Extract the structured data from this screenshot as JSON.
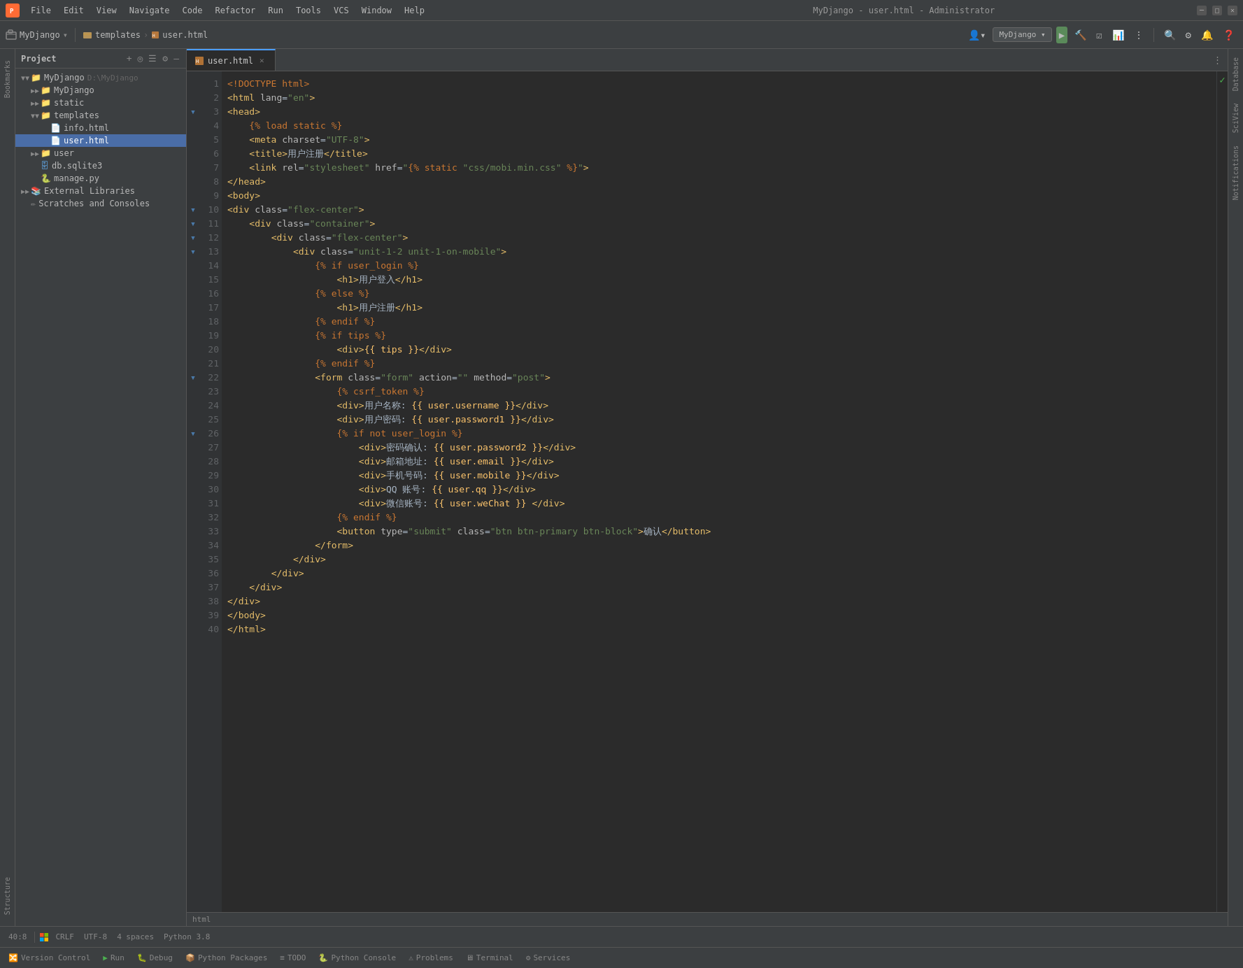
{
  "app": {
    "icon": "🔥",
    "title_bar": {
      "window_title": "MyDjango - user.html - Administrator",
      "menus": [
        "File",
        "Edit",
        "View",
        "Navigate",
        "Code",
        "Refactor",
        "Run",
        "Tools",
        "VCS",
        "Window",
        "Help"
      ],
      "min_btn": "─",
      "max_btn": "□",
      "close_btn": "✕"
    }
  },
  "toolbar": {
    "project_label": "MyDjango",
    "breadcrumb": [
      "templates",
      "user.html"
    ],
    "profile_btn": "👤",
    "project_selector": "MyDjango ▾",
    "run_btn": "▶",
    "more_btn": "⋮"
  },
  "sidebar": {
    "header": "Project",
    "tree": [
      {
        "id": "mydjango-root",
        "label": "MyDjango",
        "path": "D:\\MyDjango",
        "type": "folder",
        "level": 0,
        "open": true
      },
      {
        "id": "mydjango-inner",
        "label": "MyDjango",
        "type": "folder",
        "level": 1,
        "open": false
      },
      {
        "id": "static",
        "label": "static",
        "type": "folder",
        "level": 1,
        "open": false
      },
      {
        "id": "templates",
        "label": "templates",
        "type": "folder",
        "level": 1,
        "open": true
      },
      {
        "id": "info-html",
        "label": "info.html",
        "type": "html",
        "level": 2
      },
      {
        "id": "user-html",
        "label": "user.html",
        "type": "html",
        "level": 2,
        "selected": true
      },
      {
        "id": "user",
        "label": "user",
        "type": "folder",
        "level": 1,
        "open": false
      },
      {
        "id": "db-sqlite",
        "label": "db.sqlite3",
        "type": "db",
        "level": 1
      },
      {
        "id": "manage-py",
        "label": "manage.py",
        "type": "py",
        "level": 1
      },
      {
        "id": "ext-libs",
        "label": "External Libraries",
        "type": "folder",
        "level": 0,
        "open": false
      },
      {
        "id": "scratches",
        "label": "Scratches and Consoles",
        "type": "special",
        "level": 0
      }
    ]
  },
  "editor": {
    "tab_label": "user.html",
    "language": "html",
    "lines": [
      {
        "num": 1,
        "code": "<!DOCTYPE html>",
        "type": "doctype"
      },
      {
        "num": 2,
        "code": "<html lang=\"en\">",
        "type": "html"
      },
      {
        "num": 3,
        "code": "<head>",
        "type": "html"
      },
      {
        "num": 4,
        "code": "    {% load static %}",
        "type": "template"
      },
      {
        "num": 5,
        "code": "    <meta charset=\"UTF-8\">",
        "type": "html"
      },
      {
        "num": 6,
        "code": "    <title>用户注册</title>",
        "type": "html"
      },
      {
        "num": 7,
        "code": "    <link rel=\"stylesheet\" href=\"{% static 'css/mobi.min.css' %}\">",
        "type": "mixed"
      },
      {
        "num": 8,
        "code": "</head>",
        "type": "html"
      },
      {
        "num": 9,
        "code": "<body>",
        "type": "html"
      },
      {
        "num": 10,
        "code": "<div class=\"flex-center\">",
        "type": "html"
      },
      {
        "num": 11,
        "code": "    <div class=\"container\">",
        "type": "html"
      },
      {
        "num": 12,
        "code": "        <div class=\"flex-center\">",
        "type": "html"
      },
      {
        "num": 13,
        "code": "            <div class=\"unit-1-2 unit-1-on-mobile\">",
        "type": "html"
      },
      {
        "num": 14,
        "code": "                {% if user_login %}",
        "type": "template"
      },
      {
        "num": 15,
        "code": "                    <h1>用户登入</h1>",
        "type": "html"
      },
      {
        "num": 16,
        "code": "                {% else %}",
        "type": "template"
      },
      {
        "num": 17,
        "code": "                    <h1>用户注册</h1>",
        "type": "html"
      },
      {
        "num": 18,
        "code": "                {% endif %}",
        "type": "template"
      },
      {
        "num": 19,
        "code": "                {% if tips %}",
        "type": "template"
      },
      {
        "num": 20,
        "code": "                    <div>{{ tips }}</div>",
        "type": "mixed"
      },
      {
        "num": 21,
        "code": "                {% endif %}",
        "type": "template"
      },
      {
        "num": 22,
        "code": "                <form class=\"form\" action=\"\" method=\"post\">",
        "type": "html"
      },
      {
        "num": 23,
        "code": "                    {% csrf_token %}",
        "type": "template"
      },
      {
        "num": 24,
        "code": "                    <div>用户名称: {{ user.username }}</div>",
        "type": "mixed"
      },
      {
        "num": 25,
        "code": "                    <div>用户密码: {{ user.password1 }}</div>",
        "type": "mixed"
      },
      {
        "num": 26,
        "code": "                    {% if not user_login %}",
        "type": "template"
      },
      {
        "num": 27,
        "code": "                        <div>密码确认: {{ user.password2 }}</div>",
        "type": "mixed"
      },
      {
        "num": 28,
        "code": "                        <div>邮箱地址: {{ user.email }}</div>",
        "type": "mixed"
      },
      {
        "num": 29,
        "code": "                        <div>手机号码: {{ user.mobile }}</div>",
        "type": "mixed"
      },
      {
        "num": 30,
        "code": "                        <div>QQ 账号: {{ user.qq }}</div>",
        "type": "mixed"
      },
      {
        "num": 31,
        "code": "                        <div>微信账号: {{ user.weChat }} </div>",
        "type": "mixed"
      },
      {
        "num": 32,
        "code": "                    {% endif %}",
        "type": "template"
      },
      {
        "num": 33,
        "code": "                    <button type=\"submit\" class=\"btn btn-primary btn-block\">确认</button>",
        "type": "html"
      },
      {
        "num": 34,
        "code": "                </form>",
        "type": "html"
      },
      {
        "num": 35,
        "code": "            </div>",
        "type": "html"
      },
      {
        "num": 36,
        "code": "        </div>",
        "type": "html"
      },
      {
        "num": 37,
        "code": "    </div>",
        "type": "html"
      },
      {
        "num": 38,
        "code": "</div>",
        "type": "html"
      },
      {
        "num": 39,
        "code": "</body>",
        "type": "html"
      },
      {
        "num": 40,
        "code": "</html>",
        "type": "html"
      }
    ]
  },
  "status_bar": {
    "cursor_pos": "40:8",
    "line_sep": "CRLF",
    "encoding": "UTF-8",
    "indent": "4 spaces",
    "language": "Python 3.8"
  },
  "bottom_toolbar": {
    "items": [
      {
        "icon": "🔀",
        "label": "Version Control"
      },
      {
        "icon": "▶",
        "label": "Run"
      },
      {
        "icon": "🐛",
        "label": "Debug"
      },
      {
        "icon": "📦",
        "label": "Python Packages"
      },
      {
        "icon": "≡",
        "label": "TODO"
      },
      {
        "icon": "🐍",
        "label": "Python Console"
      },
      {
        "icon": "⚠",
        "label": "Problems"
      },
      {
        "icon": "🖥",
        "label": "Terminal"
      },
      {
        "icon": "⚙",
        "label": "Services"
      }
    ]
  },
  "right_panel": {
    "tabs": [
      "Database",
      "SciView",
      "Notifications"
    ]
  }
}
